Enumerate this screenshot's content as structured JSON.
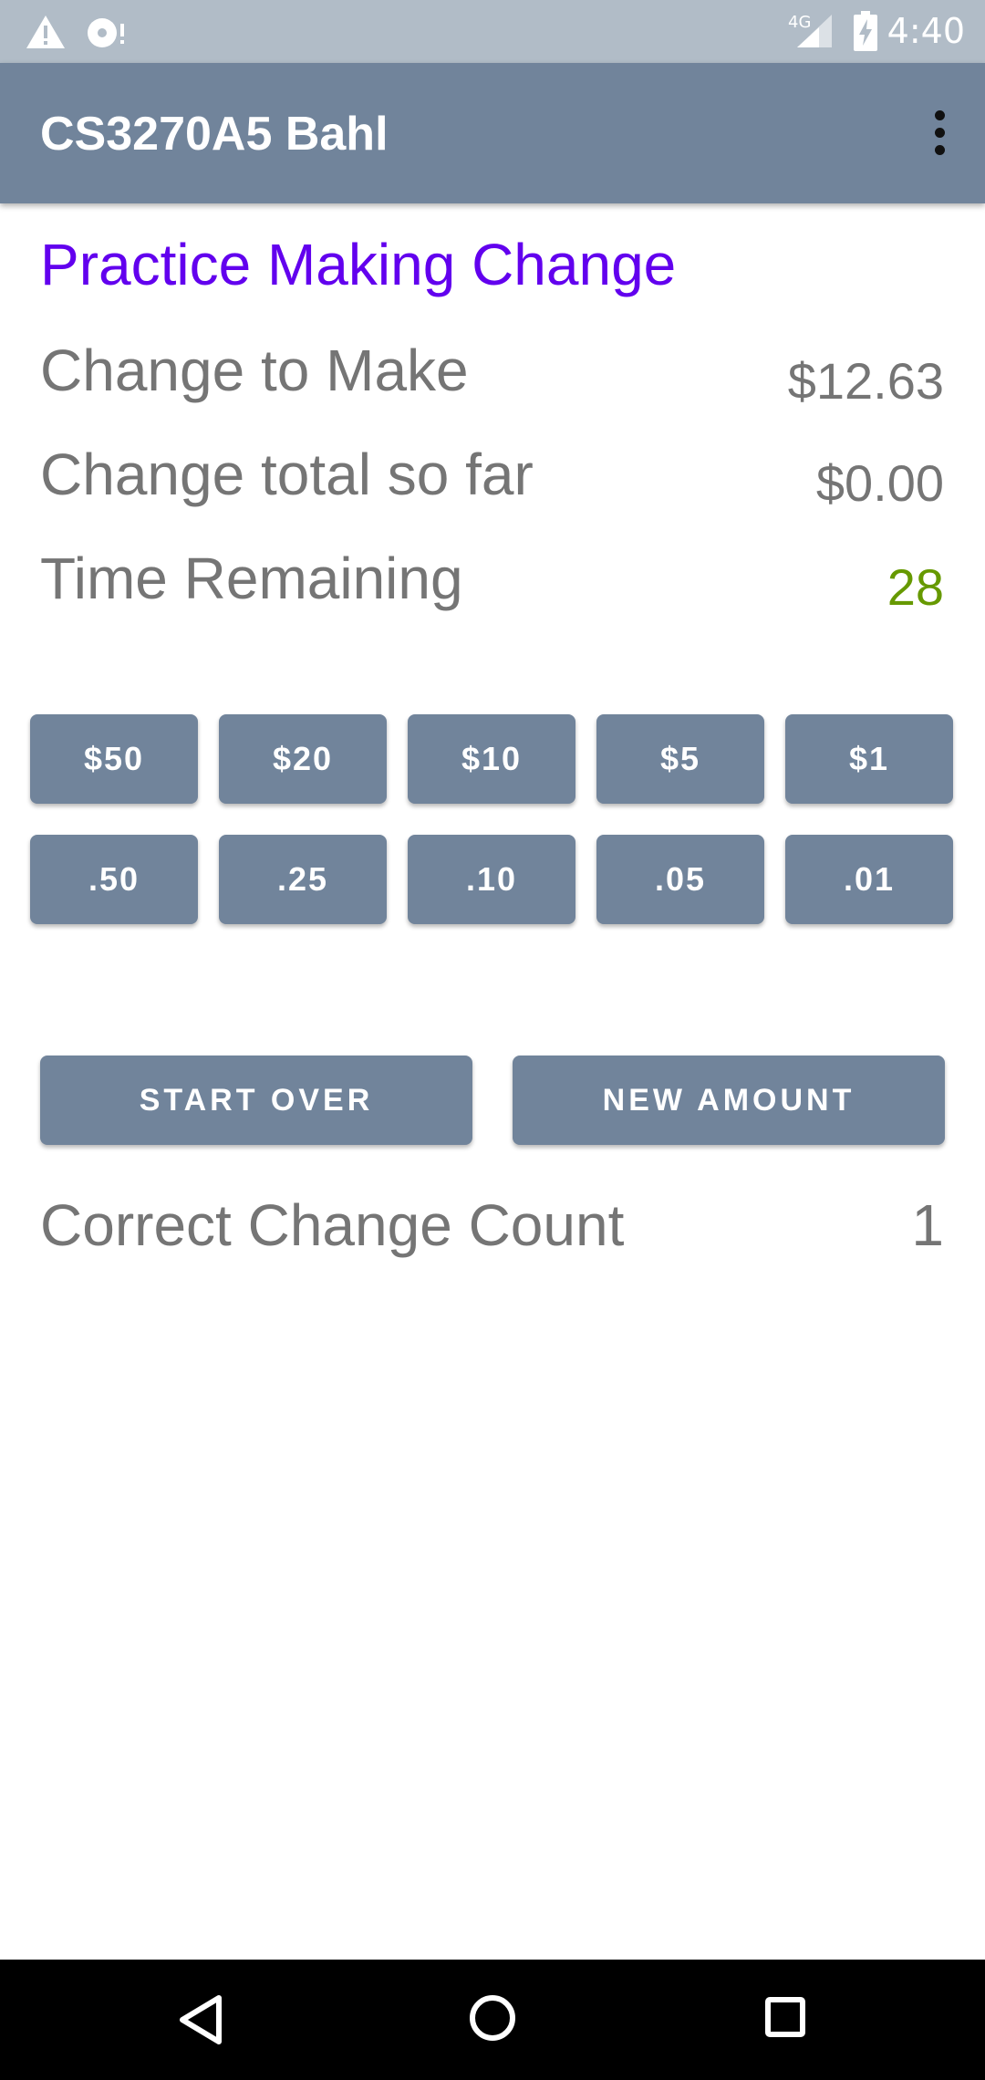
{
  "status_bar": {
    "time": "4:40",
    "network": "4G",
    "icons": [
      "warning-icon",
      "sync-disc-icon",
      "cell-signal-icon",
      "battery-charging-icon"
    ]
  },
  "app_bar": {
    "title": "CS3270A5 Bahl",
    "menu_icon": "more-vert-icon"
  },
  "main": {
    "heading": "Practice Making Change",
    "change_to_make_label": "Change to Make",
    "change_to_make_value": "$12.63",
    "total_so_far_label": "Change total so far",
    "total_so_far_value": "$0.00",
    "time_remaining_label": "Time Remaining",
    "time_remaining_value": "28",
    "bills": [
      "$50",
      "$20",
      "$10",
      "$5",
      "$1"
    ],
    "coins": [
      ".50",
      ".25",
      ".10",
      ".05",
      ".01"
    ],
    "start_over_label": "START OVER",
    "new_amount_label": "NEW AMOUNT",
    "correct_count_label": "Correct Change Count",
    "correct_count_value": "1"
  },
  "nav_bar": {
    "icons": [
      "back-icon",
      "home-icon",
      "recents-icon"
    ]
  },
  "colors": {
    "primary": "#71849b",
    "accent_text": "#6200ee",
    "timer": "#669900",
    "status_bar": "#b1bcc7"
  }
}
